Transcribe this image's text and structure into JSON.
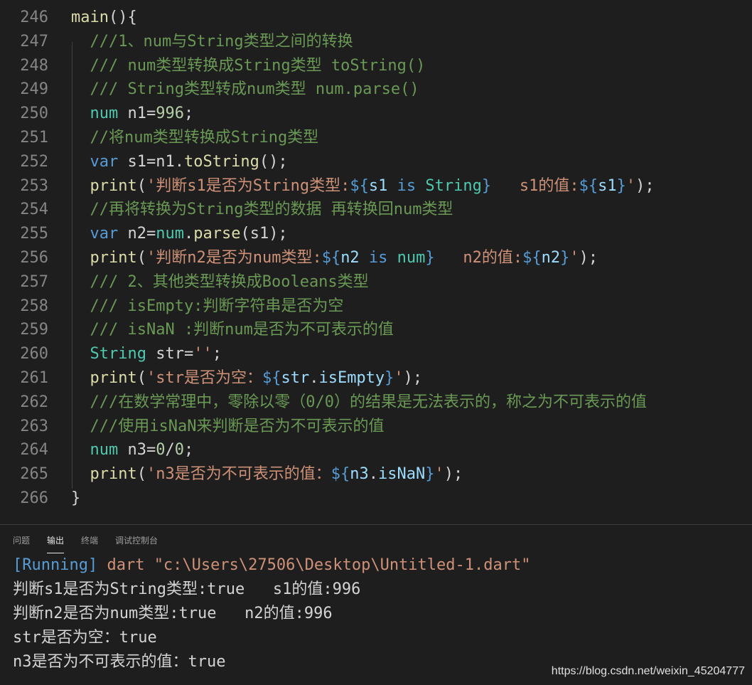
{
  "editor": {
    "lines": [
      {
        "n": "246",
        "tokens": [
          [
            "fn",
            "main"
          ],
          [
            "pun",
            "(){"
          ]
        ]
      },
      {
        "n": "247",
        "tokens": [
          [
            "com",
            "  ///1、num与String类型之间的转换"
          ]
        ]
      },
      {
        "n": "248",
        "tokens": [
          [
            "com",
            "  /// num类型转换成String类型 toString()"
          ]
        ]
      },
      {
        "n": "249",
        "tokens": [
          [
            "com",
            "  /// String类型转成num类型 num.parse()"
          ]
        ]
      },
      {
        "n": "250",
        "tokens": [
          [
            "type",
            "  num"
          ],
          [
            "pun",
            " n1="
          ],
          [
            "num",
            "996"
          ],
          [
            "pun",
            ";"
          ]
        ]
      },
      {
        "n": "251",
        "tokens": [
          [
            "com",
            "  //将num类型转换成String类型"
          ]
        ]
      },
      {
        "n": "252",
        "tokens": [
          [
            "kw",
            "  var"
          ],
          [
            "pun",
            " s1=n1."
          ],
          [
            "fn",
            "toString"
          ],
          [
            "pun",
            "();"
          ]
        ]
      },
      {
        "n": "253",
        "tokens": [
          [
            "fn",
            "  print"
          ],
          [
            "pun",
            "("
          ],
          [
            "str",
            "'判断s1是否为String类型:"
          ],
          [
            "int",
            "${"
          ],
          [
            "var",
            "s1"
          ],
          [
            "kw",
            " is"
          ],
          [
            "type",
            " String"
          ],
          [
            "int",
            "}"
          ],
          [
            "str",
            "   s1的值:"
          ],
          [
            "int",
            "${"
          ],
          [
            "var",
            "s1"
          ],
          [
            "int",
            "}"
          ],
          [
            "str",
            "'"
          ],
          [
            "pun",
            ");"
          ]
        ]
      },
      {
        "n": "254",
        "tokens": [
          [
            "com",
            "  //再将转换为String类型的数据 再转换回num类型"
          ]
        ]
      },
      {
        "n": "255",
        "tokens": [
          [
            "kw",
            "  var"
          ],
          [
            "pun",
            " n2="
          ],
          [
            "type",
            "num"
          ],
          [
            "pun",
            "."
          ],
          [
            "fn",
            "parse"
          ],
          [
            "pun",
            "(s1);"
          ]
        ]
      },
      {
        "n": "256",
        "tokens": [
          [
            "fn",
            "  print"
          ],
          [
            "pun",
            "("
          ],
          [
            "str",
            "'判断n2是否为num类型:"
          ],
          [
            "int",
            "${"
          ],
          [
            "var",
            "n2"
          ],
          [
            "kw",
            " is"
          ],
          [
            "type",
            " num"
          ],
          [
            "int",
            "}"
          ],
          [
            "str",
            "   n2的值:"
          ],
          [
            "int",
            "${"
          ],
          [
            "var",
            "n2"
          ],
          [
            "int",
            "}"
          ],
          [
            "str",
            "'"
          ],
          [
            "pun",
            ");"
          ]
        ]
      },
      {
        "n": "257",
        "tokens": [
          [
            "com",
            "  /// 2、其他类型转换成Booleans类型"
          ]
        ]
      },
      {
        "n": "258",
        "tokens": [
          [
            "com",
            "  /// isEmpty:判断字符串是否为空"
          ]
        ]
      },
      {
        "n": "259",
        "tokens": [
          [
            "com",
            "  /// isNaN :判断num是否为不可表示的值"
          ]
        ]
      },
      {
        "n": "260",
        "tokens": [
          [
            "type",
            "  String"
          ],
          [
            "pun",
            " str="
          ],
          [
            "str",
            "''"
          ],
          [
            "pun",
            ";"
          ]
        ]
      },
      {
        "n": "261",
        "tokens": [
          [
            "fn",
            "  print"
          ],
          [
            "pun",
            "("
          ],
          [
            "str",
            "'str是否为空："
          ],
          [
            "int",
            "${"
          ],
          [
            "var",
            "str"
          ],
          [
            "pun",
            "."
          ],
          [
            "var",
            "isEmpty"
          ],
          [
            "int",
            "}"
          ],
          [
            "str",
            "'"
          ],
          [
            "pun",
            ");"
          ]
        ]
      },
      {
        "n": "262",
        "tokens": [
          [
            "com",
            "  ///在数学常理中，零除以零（0/0）的结果是无法表示的，称之为不可表示的值"
          ]
        ]
      },
      {
        "n": "263",
        "tokens": [
          [
            "com",
            "  ///使用isNaN来判断是否为不可表示的值"
          ]
        ]
      },
      {
        "n": "264",
        "tokens": [
          [
            "type",
            "  num"
          ],
          [
            "pun",
            " n3="
          ],
          [
            "num",
            "0"
          ],
          [
            "pun",
            "/"
          ],
          [
            "num",
            "0"
          ],
          [
            "pun",
            ";"
          ]
        ]
      },
      {
        "n": "265",
        "tokens": [
          [
            "fn",
            "  print"
          ],
          [
            "pun",
            "("
          ],
          [
            "str",
            "'n3是否为不可表示的值："
          ],
          [
            "int",
            "${"
          ],
          [
            "var",
            "n3"
          ],
          [
            "pun",
            "."
          ],
          [
            "var",
            "isNaN"
          ],
          [
            "int",
            "}"
          ],
          [
            "str",
            "'"
          ],
          [
            "pun",
            ");"
          ]
        ]
      },
      {
        "n": "266",
        "tokens": [
          [
            "pun",
            "}"
          ]
        ]
      }
    ]
  },
  "panel": {
    "tabs": [
      {
        "label": "问题",
        "active": false
      },
      {
        "label": "输出",
        "active": true
      },
      {
        "label": "终端",
        "active": false
      },
      {
        "label": "调试控制台",
        "active": false
      }
    ],
    "running_tag": "[Running]",
    "running_cmd": " dart \"c:\\Users\\27506\\Desktop\\Untitled-1.dart\"",
    "output_lines": [
      "判断s1是否为String类型:true   s1的值:996",
      "判断n2是否为num类型:true   n2的值:996",
      "str是否为空：true",
      "n3是否为不可表示的值：true"
    ]
  },
  "watermark": "https://blog.csdn.net/weixin_45204777"
}
